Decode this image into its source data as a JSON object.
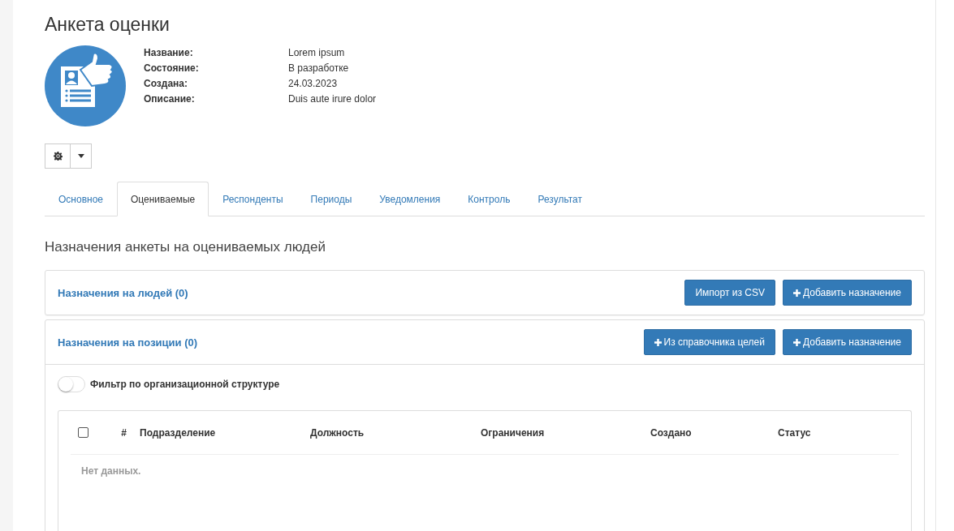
{
  "title": "Анкета оценки",
  "details": [
    {
      "label": "Название:",
      "value": "Lorem ipsum"
    },
    {
      "label": "Состояние:",
      "value": "В разработке"
    },
    {
      "label": "Создана:",
      "value": "24.03.2023"
    },
    {
      "label": "Описание:",
      "value": "Duis aute irure dolor"
    }
  ],
  "tabs": [
    {
      "label": "Основное",
      "selected": false
    },
    {
      "label": "Оцениваемые",
      "selected": true
    },
    {
      "label": "Респонденты",
      "selected": false
    },
    {
      "label": "Периоды",
      "selected": false
    },
    {
      "label": "Уведомления",
      "selected": false
    },
    {
      "label": "Контроль",
      "selected": false
    },
    {
      "label": "Результат",
      "selected": false
    }
  ],
  "section_title": "Назначения анкеты на оцениваемых людей",
  "panels": [
    {
      "title": "Назначения на людей (0)",
      "buttons": [
        {
          "label": "Импорт из CSV",
          "kind": "plain"
        },
        {
          "label": "Добавить назначение",
          "kind": "plus"
        }
      ]
    },
    {
      "title": "Назначения на позиции (0)",
      "buttons": [
        {
          "label": "Из справочника целей",
          "kind": "plus"
        },
        {
          "label": "Добавить назначение",
          "kind": "plus"
        }
      ],
      "filter": {
        "label": "Фильтр по организационной структуре",
        "on": false
      },
      "table": {
        "select_all": {
          "checked": false
        },
        "columns": [
          "#",
          "Подразделение",
          "Должность",
          "Ограничения",
          "Создано",
          "Статус"
        ],
        "empty": "Нет данных."
      }
    }
  ]
}
